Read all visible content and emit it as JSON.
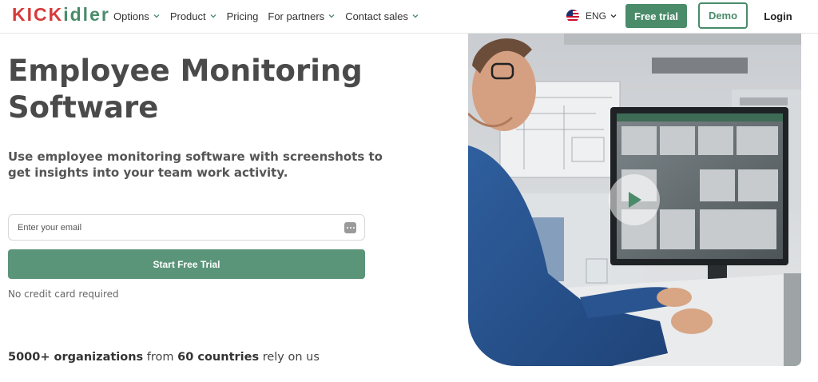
{
  "header": {
    "logo": {
      "part1": "KICK",
      "part2": "idler"
    },
    "nav": [
      {
        "label": "Options",
        "dropdown": true
      },
      {
        "label": "Product",
        "dropdown": true
      },
      {
        "label": "Pricing",
        "dropdown": false
      },
      {
        "label": "For partners",
        "dropdown": true
      },
      {
        "label": "Contact sales",
        "dropdown": true
      }
    ],
    "language": "ENG",
    "free_trial_label": "Free trial",
    "demo_label": "Demo",
    "login_label": "Login"
  },
  "hero": {
    "title": "Employee Monitoring Software",
    "subtitle": "Use employee monitoring software with screenshots to get insights into your team work activity.",
    "email_placeholder": "Enter your email",
    "start_label": "Start Free Trial",
    "no_credit_card": "No credit card required"
  },
  "social_proof": {
    "orgs_count": "5000+ organizations",
    "from": "from",
    "countries": "60 countries",
    "rely": "rely on us"
  },
  "colors": {
    "brand_green": "#4a8b6a",
    "brand_red": "#d63a3a",
    "cta_green": "#5a957a"
  },
  "icons": [
    "chevron-down-icon",
    "us-flag-icon",
    "password-manager-icon",
    "play-icon"
  ]
}
